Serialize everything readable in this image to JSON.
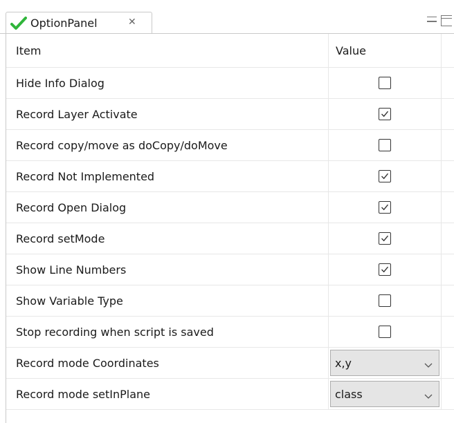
{
  "tab": {
    "title": "OptionPanel",
    "close_glyph": "✕",
    "icon": "green-check-icon",
    "icon_color": "#2fb53a"
  },
  "table": {
    "columns": [
      "Item",
      "Value"
    ],
    "rows": [
      {
        "item": "Hide Info Dialog",
        "type": "checkbox",
        "checked": false
      },
      {
        "item": "Record Layer Activate",
        "type": "checkbox",
        "checked": true
      },
      {
        "item": "Record copy/move as doCopy/doMove",
        "type": "checkbox",
        "checked": false
      },
      {
        "item": "Record Not Implemented",
        "type": "checkbox",
        "checked": true
      },
      {
        "item": "Record Open Dialog",
        "type": "checkbox",
        "checked": true
      },
      {
        "item": "Record setMode",
        "type": "checkbox",
        "checked": true
      },
      {
        "item": "Show Line Numbers",
        "type": "checkbox",
        "checked": true
      },
      {
        "item": "Show Variable Type",
        "type": "checkbox",
        "checked": false
      },
      {
        "item": "Stop recording when script is saved",
        "type": "checkbox",
        "checked": false
      },
      {
        "item": "Record mode Coordinates",
        "type": "combo",
        "value": "x,y"
      },
      {
        "item": "Record mode setInPlane",
        "type": "combo",
        "value": "class"
      }
    ]
  },
  "colors": {
    "border": "#c9c9c9",
    "grid_line": "#e7e7e7",
    "combo_bg": "#e5e5e5"
  }
}
